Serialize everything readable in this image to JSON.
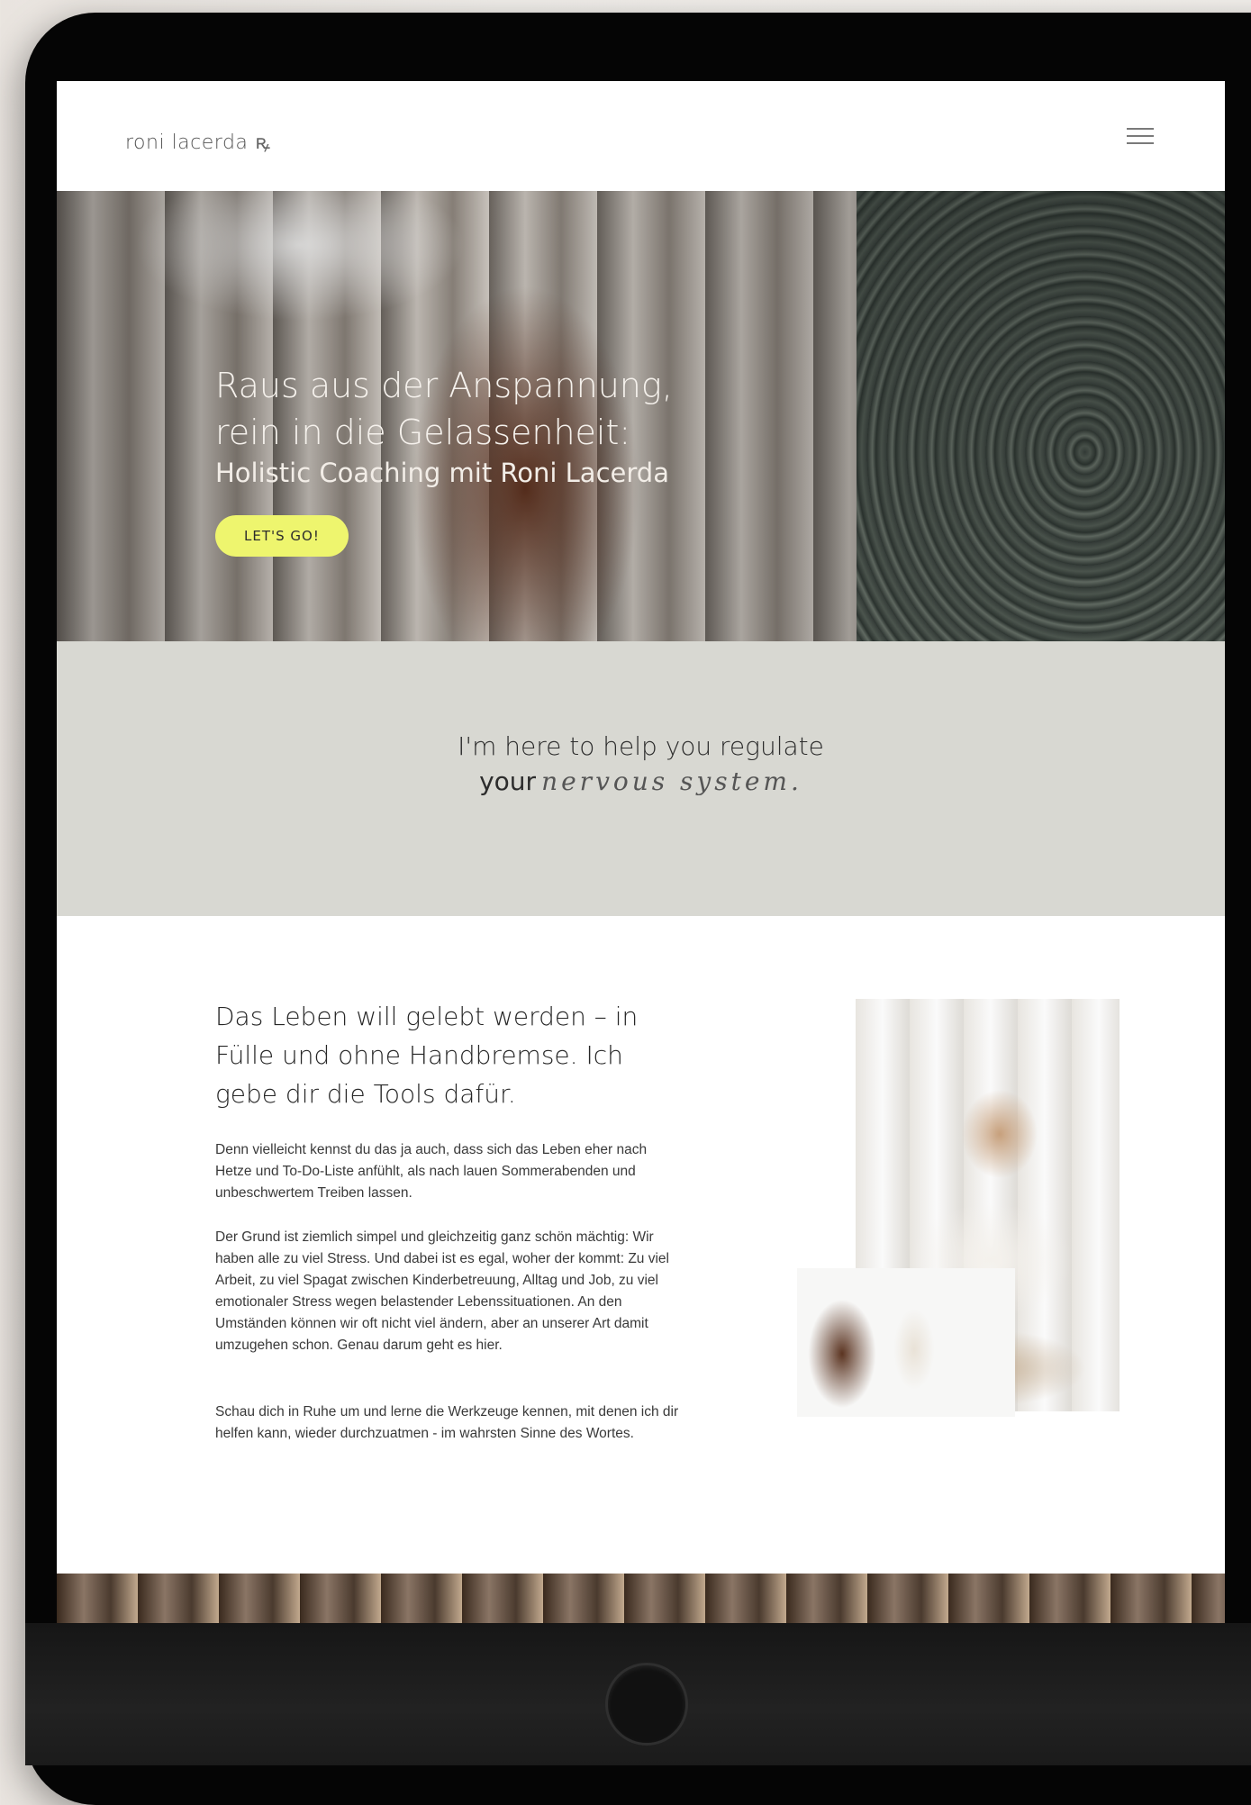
{
  "header": {
    "logo_text": "roni lacerda",
    "logo_mark": "ꝶ"
  },
  "hero": {
    "title_line1": "Raus aus der Anspannung,",
    "title_line2": "rein in die Gelassenheit:",
    "subtitle": "Holistic Coaching mit Roni Lacerda",
    "cta_label": "LET'S GO!",
    "cta_color": "#eef56e"
  },
  "band": {
    "line1": "I'm here to help you regulate",
    "line2_prefix": "your",
    "line2_script": "nervous system.",
    "background": "#d8d8d2"
  },
  "intro": {
    "heading": "Das Leben will gelebt werden – in Fülle und ohne Handbremse. Ich gebe dir die Tools dafür.",
    "paragraphs": [
      "Denn vielleicht kennst du das ja auch, dass sich das Leben eher nach Hetze und To-Do-Liste anfühlt, als nach lauen Sommerabenden und unbeschwertem Treiben lassen.",
      "Der Grund ist ziemlich simpel und gleichzeitig ganz schön mächtig: Wir haben alle zu viel Stress. Und dabei ist es egal, woher der kommt: Zu viel Arbeit, zu viel Spagat zwischen Kinderbetreuung, Alltag und Job, zu viel emotionaler Stress wegen belastender Lebenssituationen. An den Umständen können wir oft nicht viel ändern, aber an unserer Art damit umzugehen schon. Genau darum geht es hier.",
      "Schau dich in Ruhe um und lerne die Werkzeuge kennen, mit denen ich dir helfen kann, wieder durchzuatmen - im wahrsten Sinne des Wortes."
    ]
  },
  "icons": {
    "menu": "hamburger-menu-icon"
  }
}
